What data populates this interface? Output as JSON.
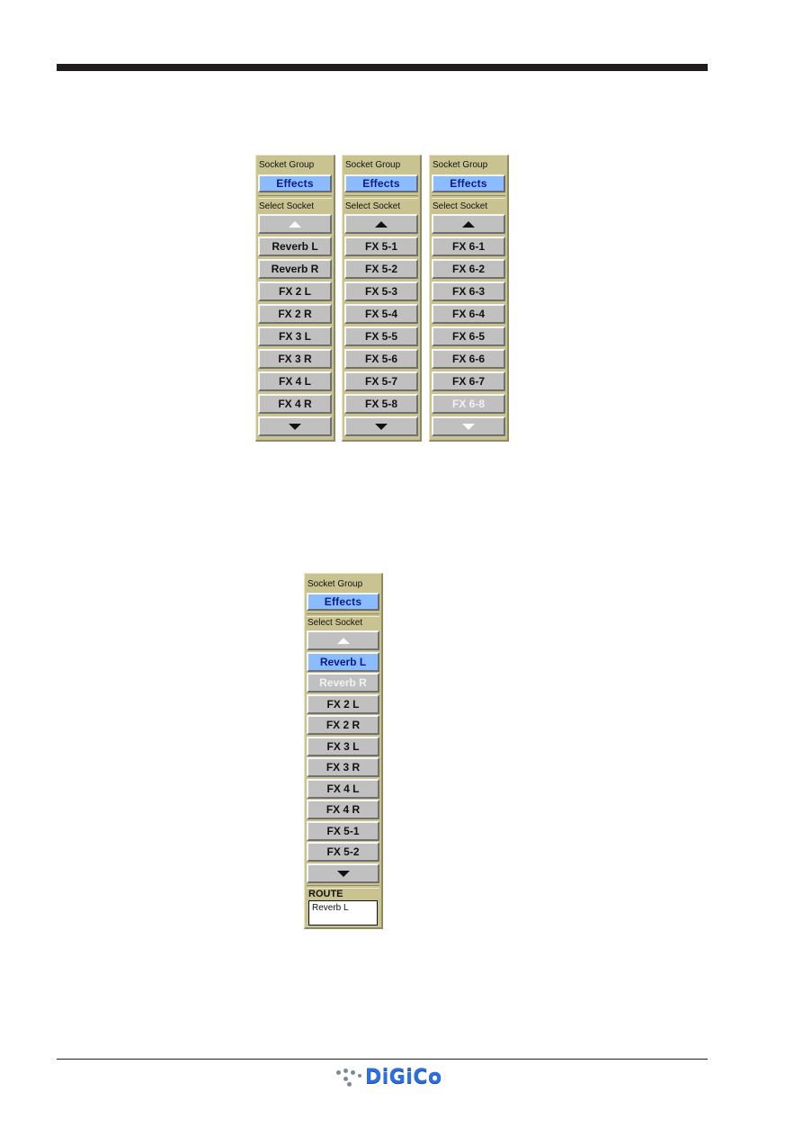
{
  "document": {
    "brand": "DiGiCo"
  },
  "panels_top": [
    {
      "socket_group_label": "Socket Group",
      "group_button": "Effects",
      "select_socket_label": "Select Socket",
      "up_arrow_dimmed": true,
      "down_arrow_dimmed": false,
      "sockets": [
        {
          "label": "Reverb L",
          "state": "normal"
        },
        {
          "label": "Reverb R",
          "state": "normal"
        },
        {
          "label": "FX 2 L",
          "state": "normal"
        },
        {
          "label": "FX 2 R",
          "state": "normal"
        },
        {
          "label": "FX 3 L",
          "state": "normal"
        },
        {
          "label": "FX 3 R",
          "state": "normal"
        },
        {
          "label": "FX 4 L",
          "state": "normal"
        },
        {
          "label": "FX 4 R",
          "state": "normal"
        }
      ]
    },
    {
      "socket_group_label": "Socket Group",
      "group_button": "Effects",
      "select_socket_label": "Select Socket",
      "up_arrow_dimmed": false,
      "down_arrow_dimmed": false,
      "sockets": [
        {
          "label": "FX 5-1",
          "state": "normal"
        },
        {
          "label": "FX 5-2",
          "state": "normal"
        },
        {
          "label": "FX 5-3",
          "state": "normal"
        },
        {
          "label": "FX 5-4",
          "state": "normal"
        },
        {
          "label": "FX 5-5",
          "state": "normal"
        },
        {
          "label": "FX 5-6",
          "state": "normal"
        },
        {
          "label": "FX 5-7",
          "state": "normal"
        },
        {
          "label": "FX 5-8",
          "state": "normal"
        }
      ]
    },
    {
      "socket_group_label": "Socket Group",
      "group_button": "Effects",
      "select_socket_label": "Select Socket",
      "up_arrow_dimmed": false,
      "down_arrow_dimmed": true,
      "sockets": [
        {
          "label": "FX 6-1",
          "state": "normal"
        },
        {
          "label": "FX 6-2",
          "state": "normal"
        },
        {
          "label": "FX 6-3",
          "state": "normal"
        },
        {
          "label": "FX 6-4",
          "state": "normal"
        },
        {
          "label": "FX 6-5",
          "state": "normal"
        },
        {
          "label": "FX 6-6",
          "state": "normal"
        },
        {
          "label": "FX 6-7",
          "state": "normal"
        },
        {
          "label": "FX 6-8",
          "state": "dimmed"
        }
      ]
    }
  ],
  "panel_bottom": {
    "socket_group_label": "Socket Group",
    "group_button": "Effects",
    "select_socket_label": "Select Socket",
    "up_arrow_dimmed": true,
    "down_arrow_dimmed": false,
    "sockets": [
      {
        "label": "Reverb L",
        "state": "selected"
      },
      {
        "label": "Reverb R",
        "state": "dimmed"
      },
      {
        "label": "FX 2 L",
        "state": "normal"
      },
      {
        "label": "FX 2 R",
        "state": "normal"
      },
      {
        "label": "FX 3 L",
        "state": "normal"
      },
      {
        "label": "FX 3 R",
        "state": "normal"
      },
      {
        "label": "FX 4 L",
        "state": "normal"
      },
      {
        "label": "FX 4 R",
        "state": "normal"
      },
      {
        "label": "FX 5-1",
        "state": "normal"
      },
      {
        "label": "FX 5-2",
        "state": "normal"
      }
    ],
    "route_label": "ROUTE",
    "route_value": "Reverb L"
  },
  "colors": {
    "panel_bg": "#c9c392",
    "selected_blue": "#8bbcff",
    "selected_text": "#0a1a8c",
    "button_grey": "#c0c0c0"
  }
}
